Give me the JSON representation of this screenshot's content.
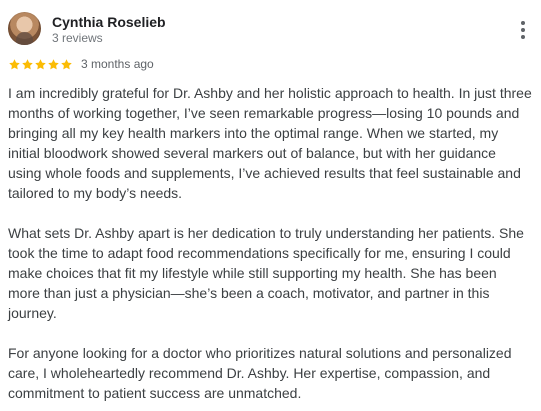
{
  "review": {
    "reviewer_name": "Cynthia Roselieb",
    "reviewer_meta": "3 reviews",
    "rating": 5,
    "rating_max": 5,
    "time": "3 months ago",
    "paragraphs": [
      "I am incredibly grateful for Dr. Ashby and her holistic approach to health. In just three months of working together, I’ve seen remarkable progress—losing 10 pounds and bringing all my key health markers into the optimal range. When we started, my initial bloodwork showed several markers out of balance, but with her guidance using whole foods and supplements, I’ve achieved results that feel sustainable and tailored to my body’s needs.",
      "What sets Dr. Ashby apart is her dedication to truly understanding her patients. She took the time to adapt food recommendations specifically for me, ensuring I could make choices that fit my lifestyle while still supporting my health. She has been more than just a physician—she’s been a coach, motivator, and partner in this journey.",
      "For anyone looking for a doctor who prioritizes natural solutions and personalized care, I wholeheartedly recommend Dr. Ashby. Her expertise, compassion, and commitment to patient success are unmatched."
    ]
  },
  "colors": {
    "star": "#fbbc04",
    "name": "#202124",
    "secondary_text": "#70757a",
    "body_text": "#3c4043",
    "menu": "#5f6368"
  },
  "icons": {
    "avatar": "reviewer-avatar",
    "menu": "more-vertical-icon",
    "star": "star-icon"
  }
}
